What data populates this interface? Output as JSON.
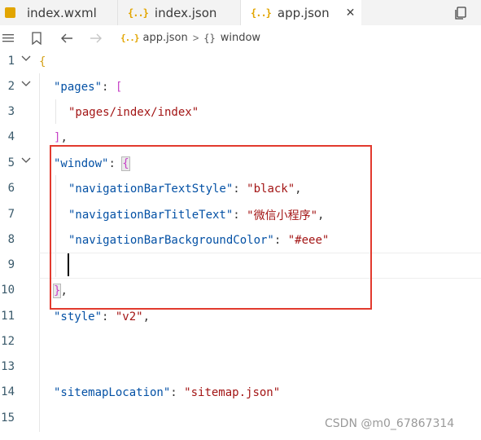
{
  "tabs": [
    {
      "label": "index.wxml",
      "icon": "wxml-file-icon"
    },
    {
      "label": "index.json",
      "icon": "json-file-icon"
    },
    {
      "label": "app.json",
      "icon": "json-file-icon",
      "active": true
    }
  ],
  "tab_icon_text": "{..}",
  "close_glyph": "✕",
  "breadcrumb": {
    "file": "app.json",
    "separator": ">",
    "object_icon": "{}",
    "symbol": "window"
  },
  "line_numbers": [
    "1",
    "2",
    "3",
    "4",
    "5",
    "6",
    "7",
    "8",
    "9",
    "10",
    "11",
    "12",
    "13",
    "14",
    "15"
  ],
  "code": {
    "l1_open": "{",
    "l2_key": "\"pages\"",
    "l2_colon": ": ",
    "l2_bracket": "[",
    "l3_value": "\"pages/index/index\"",
    "l4_bracket": "]",
    "l4_comma": ",",
    "l5_key": "\"window\"",
    "l5_colon": ": ",
    "l5_brace": "{",
    "l6_key": "\"navigationBarTextStyle\"",
    "l6_colon": ": ",
    "l6_value": "\"black\"",
    "l6_comma": ",",
    "l7_key": "\"navigationBarTitleText\"",
    "l7_colon": ": ",
    "l7_value": "\"微信小程序\"",
    "l7_comma": ",",
    "l8_key": "\"navigationBarBackgroundColor\"",
    "l8_colon": ": ",
    "l8_value": "\"#eee\"",
    "l10_brace": "}",
    "l10_comma": ",",
    "l11_key": "\"style\"",
    "l11_colon": ": ",
    "l11_value": "\"v2\"",
    "l11_comma": ",",
    "l14_key": "\"sitemapLocation\"",
    "l14_colon": ": ",
    "l14_value": "\"sitemap.json\""
  },
  "watermark": "CSDN @m0_67867314",
  "colors": {
    "key": "#0451a5",
    "string": "#a31515",
    "brace_level1": "#d4a017",
    "bracket_level2": "#c744c7",
    "highlight_border": "#e23a2e"
  }
}
